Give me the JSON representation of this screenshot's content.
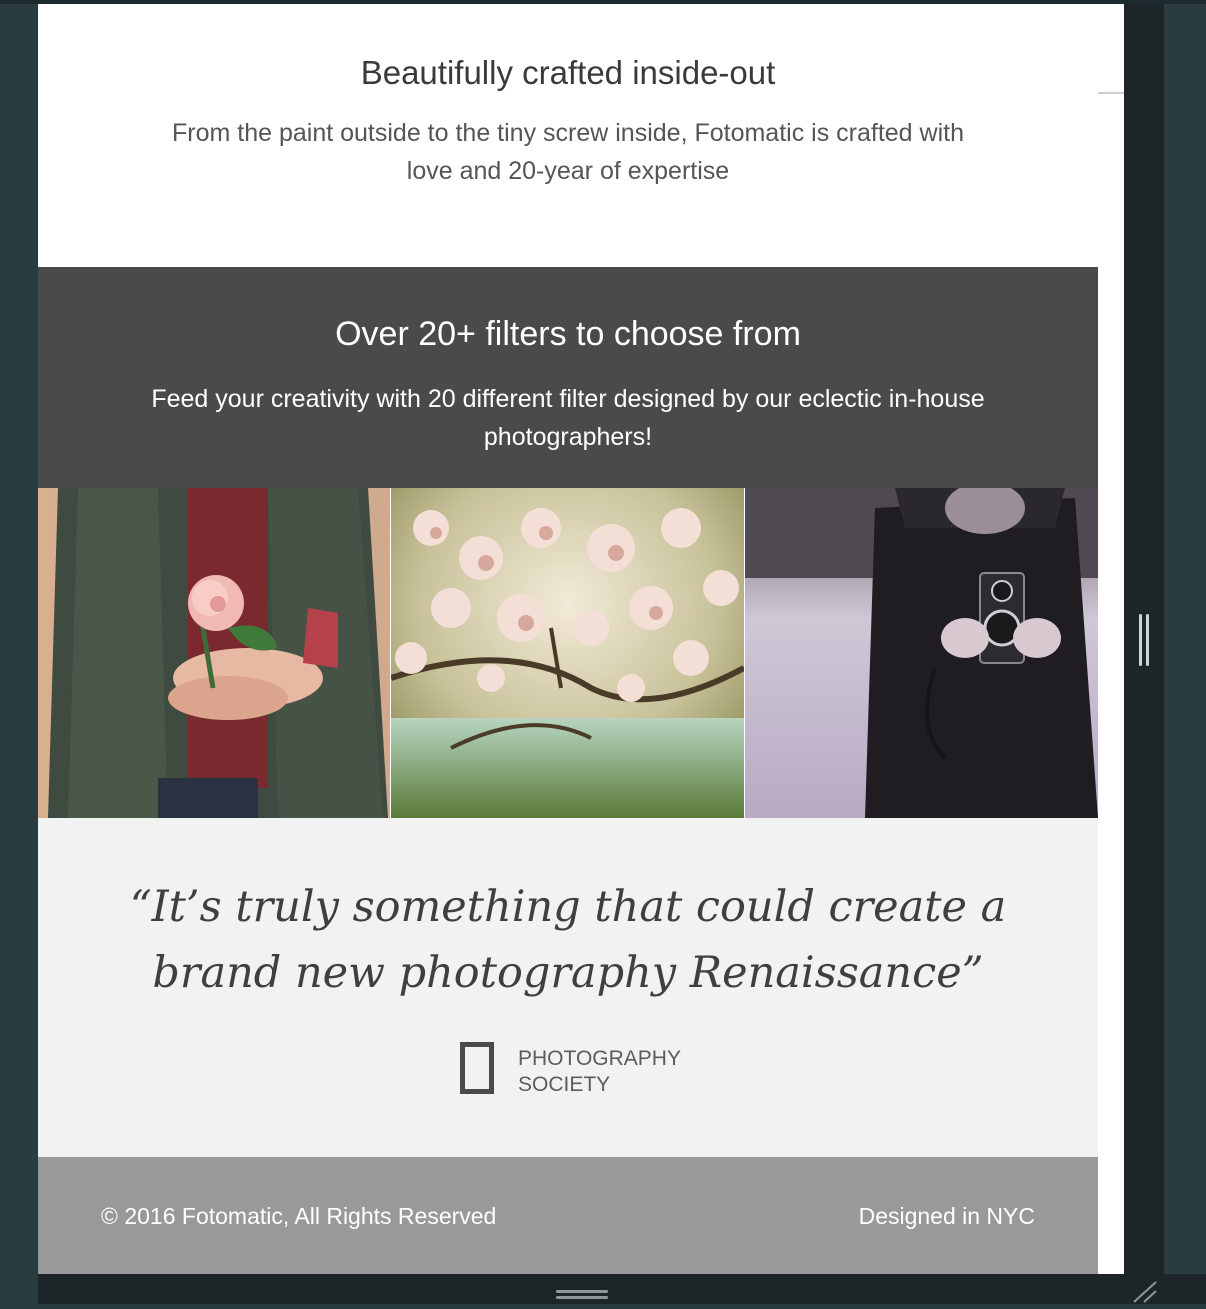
{
  "crafted": {
    "title": "Beautifully crafted inside-out",
    "description": "From the paint outside to the tiny screw inside, Fotomatic is crafted with love and 20-year of expertise"
  },
  "filters": {
    "title": "Over 20+ filters to choose from",
    "description": "Feed your creativity with 20 different filter designed by our eclectic in-house photographers!"
  },
  "photos": [
    {
      "subject": "person holding pink flower"
    },
    {
      "subject": "blossoming magnolia tree"
    },
    {
      "subject": "man holding twin-lens camera"
    }
  ],
  "testimonial": {
    "quote": "“It’s truly something that could create a brand new photography Renaissance”",
    "source_line1": "PHOTOGRAPHY",
    "source_line2": "SOCIETY"
  },
  "footer": {
    "copyright": "© 2016 Fotomatic, All Rights Reserved",
    "designed": "Designed in NYC"
  },
  "colors": {
    "filters_bg": "#4a4a4a",
    "testimonial_bg": "#f2f2f2",
    "footer_bg": "#999999"
  }
}
